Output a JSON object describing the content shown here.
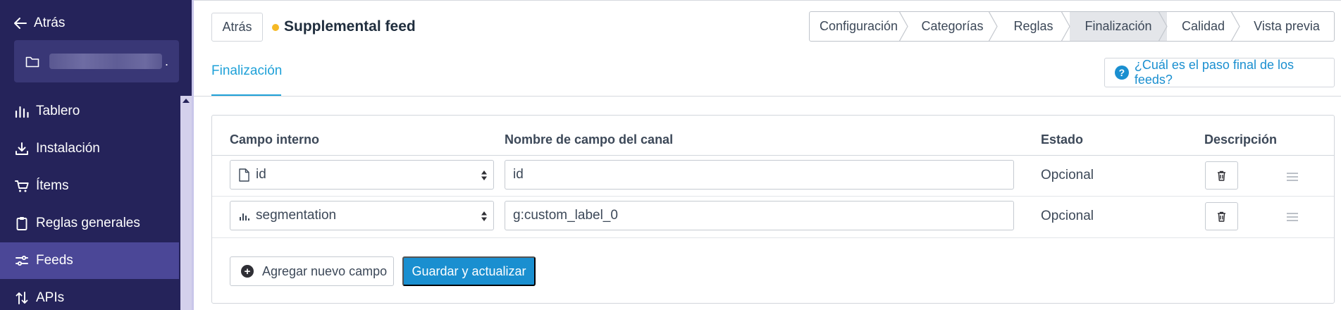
{
  "sidebar": {
    "back_label": "Atrás",
    "project": {
      "name_masked": "",
      "suffix": "."
    },
    "items": [
      {
        "label": "Tablero",
        "icon": "bar-chart-icon",
        "active": false
      },
      {
        "label": "Instalación",
        "icon": "download-icon",
        "active": false
      },
      {
        "label": "Ítems",
        "icon": "cart-icon",
        "active": false
      },
      {
        "label": "Reglas generales",
        "icon": "clipboard-icon",
        "active": false
      },
      {
        "label": "Feeds",
        "icon": "sliders-icon",
        "active": true
      },
      {
        "label": "APIs",
        "icon": "sort-arrows-icon",
        "active": false
      }
    ]
  },
  "header": {
    "back_button": "Atrás",
    "feed_title": "Supplemental feed",
    "status_color": "#f5b925"
  },
  "stepper": {
    "steps": [
      {
        "label": "Configuración"
      },
      {
        "label": "Categorías"
      },
      {
        "label": "Reglas"
      },
      {
        "label": "Finalización"
      },
      {
        "label": "Calidad"
      },
      {
        "label": "Vista previa"
      }
    ],
    "current": "Finalización"
  },
  "tabs": {
    "active": "Finalización"
  },
  "help": {
    "label": "¿Cuál es el paso final de los feeds?",
    "icon": "question-circle-icon"
  },
  "table": {
    "columns": {
      "internal": "Campo interno",
      "channel": "Nombre de campo del canal",
      "status": "Estado",
      "description": "Descripción"
    },
    "rows": [
      {
        "internal_field": "id",
        "internal_icon": "file-icon",
        "channel_field": "id",
        "status": "Opcional"
      },
      {
        "internal_field": "segmentation",
        "internal_icon": "bar-chart-icon",
        "channel_field": "g:custom_label_0",
        "status": "Opcional"
      }
    ]
  },
  "actions": {
    "add_field": "Agregar nuevo campo",
    "save": "Guardar y actualizar"
  },
  "colors": {
    "sidebar_bg": "#25235a",
    "sidebar_active": "#4b4797",
    "accent": "#1a8fd0",
    "tab_accent": "#1fa1d8"
  }
}
